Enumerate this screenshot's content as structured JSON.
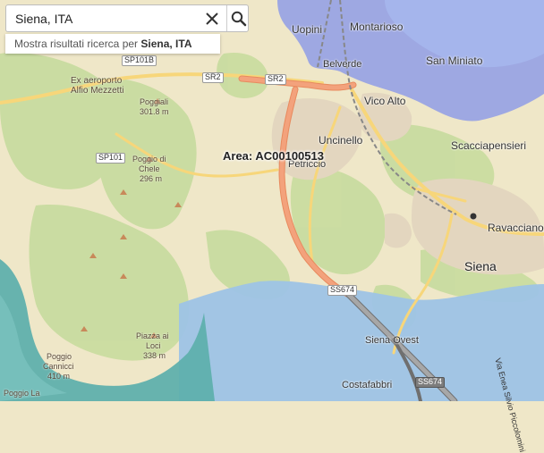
{
  "search": {
    "value": "Siena, ITA",
    "clear_icon": "close-icon",
    "search_icon": "search-icon"
  },
  "suggestion": {
    "prefix": "Mostra risultati ricerca per ",
    "term": "Siena, ITA"
  },
  "area_label": "Area: AC00100513",
  "places": {
    "uopini": "Uopini",
    "montarioso": "Montarioso",
    "belverde": "Belverde",
    "san_miniato": "San Miniato",
    "vico_alto": "Vico Alto",
    "uncinello": "Uncinello",
    "petriccio": "Petriccio",
    "scacciapensieri": "Scacciapensieri",
    "ravacciano": "Ravacciano",
    "siena": "Siena",
    "siena_ovest": "Siena Ovest",
    "costafabbri": "Costafabbri",
    "ex_aeroporto": "Ex aeroporto",
    "alfio_mezzetti": "Alfio Mezzetti",
    "via_enea": "Via Enea Silvio Piccolomini"
  },
  "peaks": {
    "poggiali_name": "Poggiali",
    "poggiali_elev": "301.8 m",
    "chele_name": "Poggio di",
    "chele_name2": "Chele",
    "chele_elev": "296 m",
    "loci_name": "Piazza ai",
    "loci_name2": "Loci",
    "loci_elev": "338 m",
    "cannicci_name": "Poggio",
    "cannicci_name2": "Cannicci",
    "cannicci_elev": "410 m",
    "la_name": "Poggio La"
  },
  "roads": {
    "sp101b": "SP101B",
    "sr2_a": "SR2",
    "sr2_b": "SR2",
    "sp101": "SP101",
    "ss674_a": "SS674",
    "ss674_b": "SS674"
  },
  "colors": {
    "land": "#efe7c8",
    "forest": "#c9dca0",
    "urban": "#e6d9c2",
    "flood_blue": "#9dc3e6",
    "flood_teal": "#5fb0ad",
    "flood_violet": "#8f9ce6",
    "major_road": "#f3a27c",
    "secondary_road": "#f7d67a",
    "motorway": "#9a9a9a"
  }
}
